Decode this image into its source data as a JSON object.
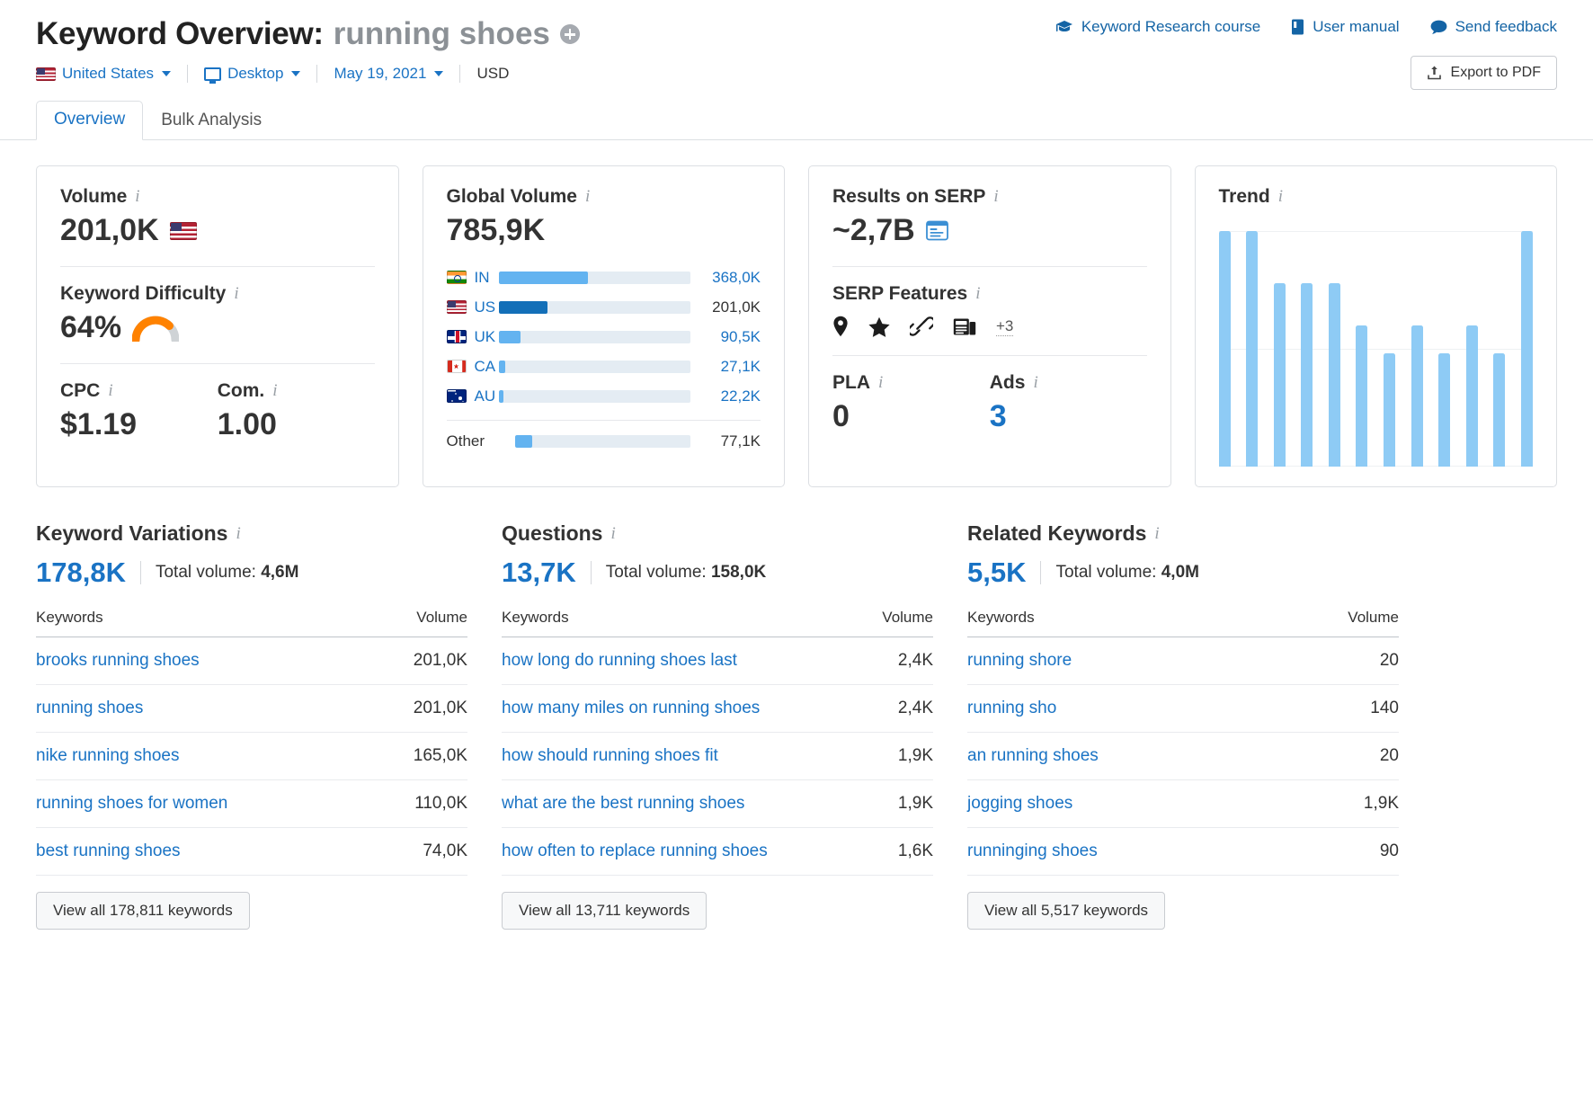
{
  "header": {
    "title_prefix": "Keyword Overview:",
    "keyword": "running shoes",
    "add_icon": "plus-circle-icon",
    "filters": {
      "country": "United States",
      "device": "Desktop",
      "date": "May 19, 2021",
      "currency": "USD"
    },
    "links": [
      {
        "label": "Keyword Research course",
        "icon": "graduation-cap-icon"
      },
      {
        "label": "User manual",
        "icon": "book-icon"
      },
      {
        "label": "Send feedback",
        "icon": "speech-bubble-icon"
      }
    ],
    "export_label": "Export to PDF",
    "export_icon": "upload-icon"
  },
  "tabs": [
    {
      "label": "Overview",
      "active": true
    },
    {
      "label": "Bulk Analysis",
      "active": false
    }
  ],
  "cards": {
    "volume": {
      "label": "Volume",
      "value": "201,0K",
      "flag": "us-flag-icon",
      "difficulty_label": "Keyword Difficulty",
      "difficulty_value": "64%",
      "difficulty_percent": 64,
      "difficulty_color": "#ff8200",
      "cpc_label": "CPC",
      "cpc_value": "$1.19",
      "com_label": "Com.",
      "com_value": "1.00"
    },
    "global_volume": {
      "label": "Global Volume",
      "value": "785,9K",
      "other_label": "Other",
      "other_value": "77,1K",
      "other_percent": 9.8,
      "rows": [
        {
          "cc": "IN",
          "flag": "in-flag-icon",
          "value": "368,0K",
          "percent": 46.8,
          "highlight": false
        },
        {
          "cc": "US",
          "flag": "us-flag-icon",
          "value": "201,0K",
          "percent": 25.6,
          "highlight": true
        },
        {
          "cc": "UK",
          "flag": "uk-flag-icon",
          "value": "90,5K",
          "percent": 11.5,
          "highlight": false
        },
        {
          "cc": "CA",
          "flag": "ca-flag-icon",
          "value": "27,1K",
          "percent": 3.4,
          "highlight": false
        },
        {
          "cc": "AU",
          "flag": "au-flag-icon",
          "value": "22,2K",
          "percent": 2.8,
          "highlight": false
        }
      ]
    },
    "serp": {
      "results_label": "Results on SERP",
      "results_value": "~2,7B",
      "results_icon": "serp-snippet-icon",
      "features_label": "SERP Features",
      "features": [
        {
          "name": "map-pin-icon"
        },
        {
          "name": "star-icon"
        },
        {
          "name": "link-icon"
        },
        {
          "name": "news-icon"
        }
      ],
      "features_more": "+3",
      "pla_label": "PLA",
      "pla_value": "0",
      "ads_label": "Ads",
      "ads_value": "3"
    },
    "trend": {
      "label": "Trend"
    }
  },
  "chart_data": {
    "type": "bar",
    "title": "Trend",
    "xlabel": "",
    "ylabel": "",
    "grid": true,
    "legend": "none",
    "ylim": [
      0,
      100
    ],
    "categories": [
      "1",
      "2",
      "3",
      "4",
      "5",
      "6",
      "7",
      "8",
      "9",
      "10",
      "11",
      "12"
    ],
    "values": [
      100,
      100,
      78,
      78,
      78,
      60,
      48,
      60,
      48,
      60,
      48,
      100
    ],
    "bar_color": "#8ecbf5"
  },
  "bottom": [
    {
      "heading": "Keyword Variations",
      "count": "178,8K",
      "total_label": "Total volume:",
      "total_value": "4,6M",
      "col_keywords": "Keywords",
      "col_volume": "Volume",
      "rows": [
        {
          "keyword": "brooks running shoes",
          "volume": "201,0K"
        },
        {
          "keyword": "running shoes",
          "volume": "201,0K"
        },
        {
          "keyword": "nike running shoes",
          "volume": "165,0K"
        },
        {
          "keyword": "running shoes for women",
          "volume": "110,0K"
        },
        {
          "keyword": "best running shoes",
          "volume": "74,0K"
        }
      ],
      "view_all": "View all 178,811 keywords"
    },
    {
      "heading": "Questions",
      "count": "13,7K",
      "total_label": "Total volume:",
      "total_value": "158,0K",
      "col_keywords": "Keywords",
      "col_volume": "Volume",
      "rows": [
        {
          "keyword": "how long do running shoes last",
          "volume": "2,4K"
        },
        {
          "keyword": "how many miles on running shoes",
          "volume": "2,4K"
        },
        {
          "keyword": "how should running shoes fit",
          "volume": "1,9K"
        },
        {
          "keyword": "what are the best running shoes",
          "volume": "1,9K"
        },
        {
          "keyword": "how often to replace running shoes",
          "volume": "1,6K"
        }
      ],
      "view_all": "View all 13,711 keywords"
    },
    {
      "heading": "Related Keywords",
      "count": "5,5K",
      "total_label": "Total volume:",
      "total_value": "4,0M",
      "col_keywords": "Keywords",
      "col_volume": "Volume",
      "rows": [
        {
          "keyword": "running shore",
          "volume": "20"
        },
        {
          "keyword": "running sho",
          "volume": "140"
        },
        {
          "keyword": "an running shoes",
          "volume": "20"
        },
        {
          "keyword": "jogging shoes",
          "volume": "1,9K"
        },
        {
          "keyword": "runninging shoes",
          "volume": "90"
        }
      ],
      "view_all": "View all 5,517 keywords"
    }
  ],
  "colors": {
    "link": "#1a73c4",
    "bar_light": "#63b3f0",
    "bar_dark": "#136fb8",
    "accent_orange": "#ff8200"
  }
}
